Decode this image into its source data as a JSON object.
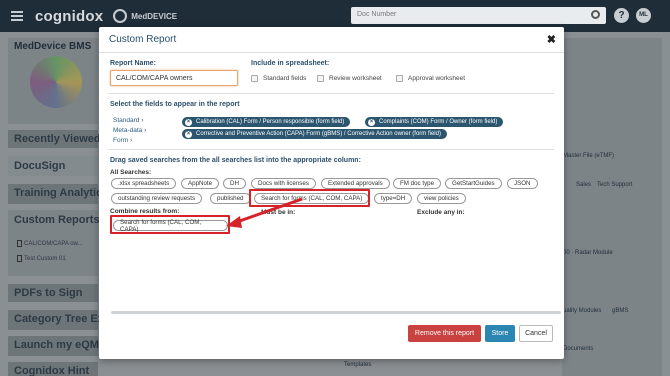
{
  "topbar": {
    "brand": "cognidox",
    "product": "MedDEVICE",
    "search_placeholder": "Doc Number",
    "help": "?",
    "avatar_initials": "ML"
  },
  "background_left": {
    "hero_title": "MedDevice BMS",
    "panels": [
      "Recently Viewed",
      "DocuSign",
      "Training Analytics",
      "Custom Reports",
      "PDFs to Sign",
      "Category Tree Exp",
      "Launch my eQMS",
      "Cognidox Hint"
    ],
    "report_links": [
      "CAL/COM/CAPA ow...",
      "Test Custom 01"
    ]
  },
  "background_right": {
    "items": [
      "Master File (eTMF)",
      "Sales",
      "Tech Support",
      "00 · Radar Module",
      "uality Modules",
      "gBMS",
      "Documents",
      "Templates"
    ]
  },
  "modal": {
    "title": "Custom Report",
    "close_icon": "✖",
    "report_name_label": "Report Name:",
    "report_name_value": "CAL/COM/CAPA owners",
    "include_label": "Include in spreadsheet:",
    "include_options": [
      "Standard fields",
      "Review worksheet",
      "Approval worksheet"
    ],
    "fields_label": "Select the fields to appear in the report",
    "field_categories": [
      "Standard",
      "Meta-data",
      "Form"
    ],
    "selected_fields": [
      "Calibration (CAL) Form / Person responsible (form field)",
      "Complaints (COM) Form / Owner (form field)",
      "Corrective and Preventive Action (CAPA) Form (gBMS) / Corrective Action owner (form field)"
    ],
    "drag_label": "Drag saved searches from the all searches list into the appropriate column:",
    "all_searches_label": "All Searches:",
    "all_searches": [
      ".xlsx spreadsheets",
      "AppNote",
      "DH",
      "Docs with licenses",
      "Extended approvals",
      "FM doc type",
      "GetStartGuides",
      "JSON",
      "outstanding review requests",
      "published",
      "Search for forms (CAL, COM, CAPA)",
      "type=DH",
      "view policies"
    ],
    "combine_label": "Combine results from:",
    "must_label": "Must be in:",
    "exclude_label": "Exclude any in:",
    "combined_item": "Search for forms (CAL, COM, CAPA)",
    "buttons": {
      "remove": "Remove this report",
      "store": "Store",
      "cancel": "Cancel"
    }
  },
  "colors": {
    "highlight": "#d6232a",
    "accent": "#2b87b1",
    "danger": "#c9423f",
    "tag": "#2c5670"
  }
}
